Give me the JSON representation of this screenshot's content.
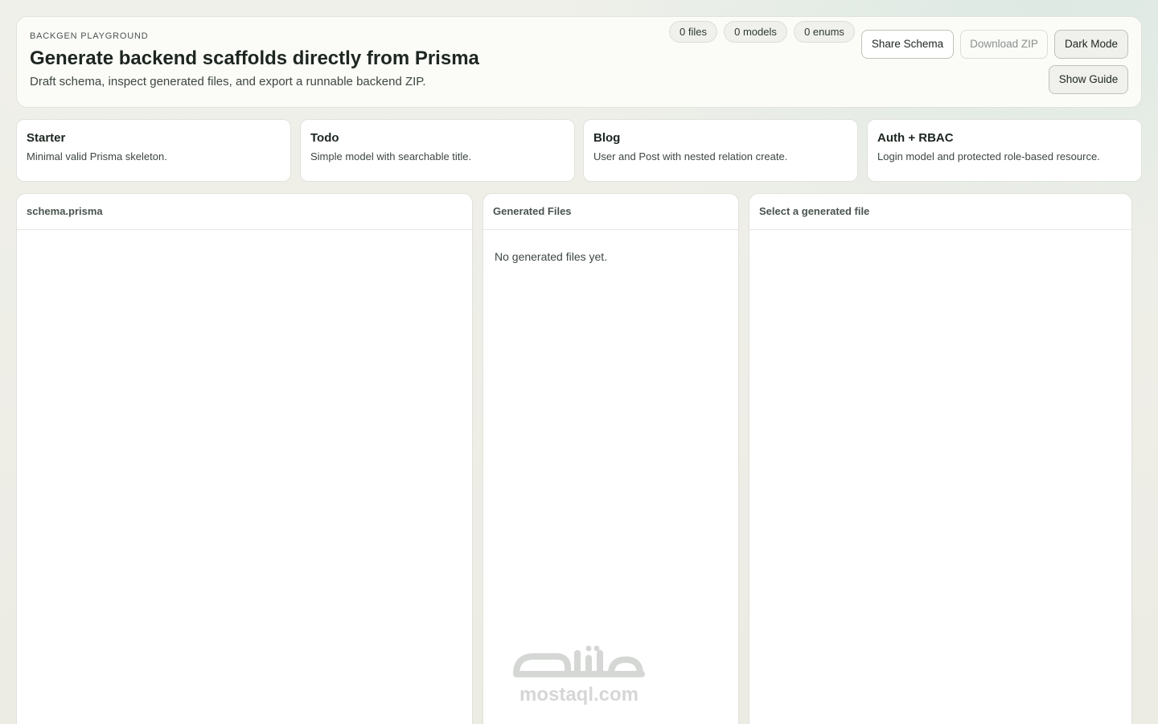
{
  "header": {
    "eyebrow": "BACKGEN PLAYGROUND",
    "title": "Generate backend scaffolds directly from Prisma",
    "subtitle": "Draft schema, inspect generated files, and export a runnable backend ZIP.",
    "stats": {
      "files": "0 files",
      "models": "0 models",
      "enums": "0 enums"
    },
    "buttons": {
      "share": "Share Schema",
      "download": "Download ZIP",
      "dark_mode": "Dark Mode",
      "guide": "Show Guide"
    }
  },
  "templates": [
    {
      "title": "Starter",
      "desc": "Minimal valid Prisma skeleton."
    },
    {
      "title": "Todo",
      "desc": "Simple model with searchable title."
    },
    {
      "title": "Blog",
      "desc": "User and Post with nested relation create."
    },
    {
      "title": "Auth + RBAC",
      "desc": "Login model and protected role-based resource."
    }
  ],
  "panels": {
    "editor": {
      "title": "schema.prisma"
    },
    "files": {
      "title": "Generated Files",
      "empty": "No generated files yet."
    },
    "viewer": {
      "title": "Select a generated file"
    }
  },
  "watermark": {
    "text": "mostaql.com"
  },
  "colors": {
    "background": "#ecebe4",
    "card": "#fbfbf8",
    "accent_tint": "#dde9e3"
  }
}
